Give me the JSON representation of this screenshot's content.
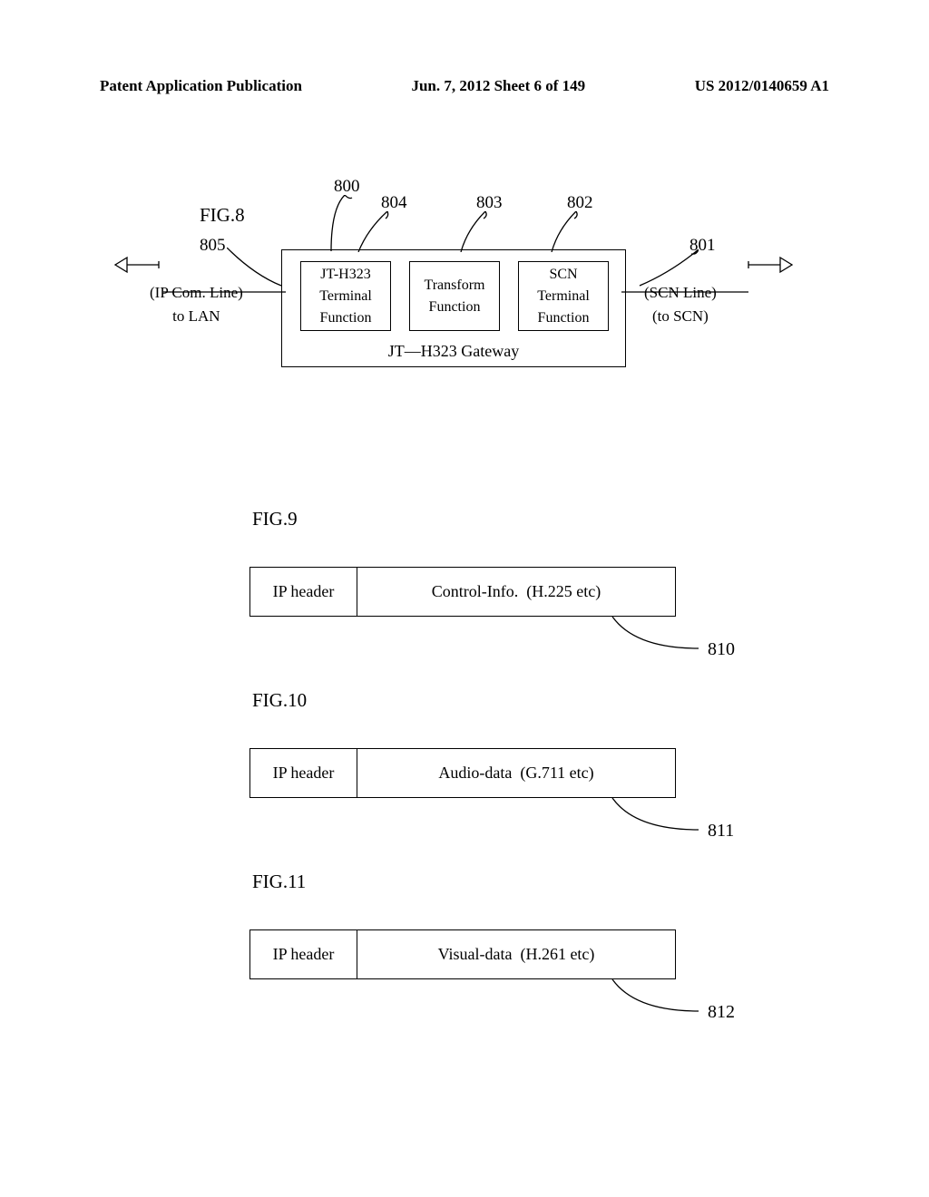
{
  "header": {
    "left": "Patent Application Publication",
    "center": "Jun. 7, 2012  Sheet 6 of 149",
    "right": "US 2012/0140659 A1"
  },
  "fig8": {
    "label": "FIG.8",
    "ref_800": "800",
    "ref_804": "804",
    "ref_803": "803",
    "ref_802": "802",
    "ref_805": "805",
    "ref_801": "801",
    "box_left_line1": "JT-H323",
    "box_left_line2": "Terminal",
    "box_left_line3": "Function",
    "box_mid_line1": "Transform",
    "box_mid_line2": "Function",
    "box_right_line1": "SCN",
    "box_right_line2": "Terminal",
    "box_right_line3": "Function",
    "gateway_caption": "JT—H323 Gateway",
    "left_line1": "(IP Com. Line)",
    "left_line2": "to LAN",
    "right_line1": "(SCN Line)",
    "right_line2": "(to SCN)"
  },
  "fig9": {
    "label": "FIG.9",
    "header": "IP header",
    "body": "Control-Info.  (H.225 etc)",
    "ref": "810"
  },
  "fig10": {
    "label": "FIG.10",
    "header": "IP header",
    "body": "Audio-data  (G.711 etc)",
    "ref": "811"
  },
  "fig11": {
    "label": "FIG.11",
    "header": "IP header",
    "body": "Visual-data  (H.261 etc)",
    "ref": "812"
  }
}
